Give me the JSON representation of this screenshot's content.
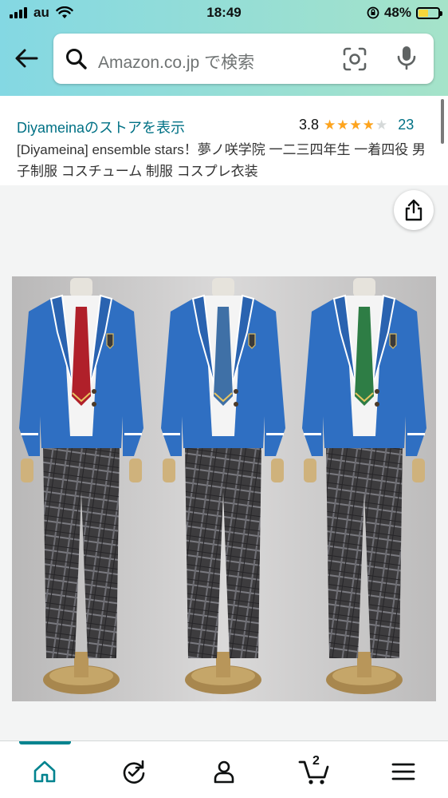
{
  "status_bar": {
    "carrier": "au",
    "time": "18:49",
    "battery": "48%"
  },
  "search": {
    "placeholder": "Amazon.co.jp で検索"
  },
  "product": {
    "store_link": "Diyameinaのストアを表示",
    "rating": "3.8",
    "rating_fraction": 0.76,
    "review_count": "23",
    "title": "[Diyameina] ensemble stars！夢ノ咲学院 一二三四年生 一着四役 男子制服 コスチューム 制服 コスプレ衣装"
  },
  "product_image": {
    "tie_colors": [
      "#b0202a",
      "#3f70a6",
      "#2e7d45"
    ],
    "jacket_color": "#2f6fc2"
  },
  "tabbar": {
    "items": [
      "home-icon",
      "refresh-icon",
      "account-icon",
      "cart-icon",
      "menu-icon"
    ],
    "cart_count": "2",
    "active_color": "#00838f"
  }
}
